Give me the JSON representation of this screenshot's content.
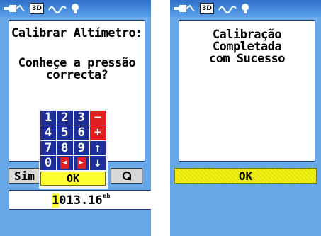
{
  "left_screen": {
    "status_icons": [
      "power-icon",
      "3d-fix-icon",
      "signal-wave-icon",
      "backlight-icon"
    ],
    "status_3d_text": "3D",
    "title": "Calibrar Altímetro:",
    "question": "Conheçe a pressão\ncorrecta?",
    "keypad": {
      "rows": [
        [
          "1",
          "2",
          "3",
          "−"
        ],
        [
          "4",
          "5",
          "6",
          "+"
        ],
        [
          "7",
          "8",
          "9",
          "↑"
        ],
        [
          "0",
          "◀",
          "▶",
          "↓"
        ]
      ],
      "ok_label": "OK"
    },
    "buttons": {
      "yes_label": "Sim",
      "no_label": "Q"
    },
    "pressure": {
      "cursor_digit": "1",
      "rest": "013.16",
      "unit": "mb"
    }
  },
  "right_screen": {
    "status_icons": [
      "power-icon",
      "3d-fix-icon",
      "signal-wave-icon",
      "backlight-icon"
    ],
    "status_3d_text": "3D",
    "message": "Calibração Completada\ncom Sucesso",
    "ok_label": "OK"
  },
  "colors": {
    "screen_bg": "#68a8e8",
    "keypad_blue": "#1d2e98",
    "keypad_red": "#e02020",
    "highlight_yellow": "#ffff30"
  }
}
